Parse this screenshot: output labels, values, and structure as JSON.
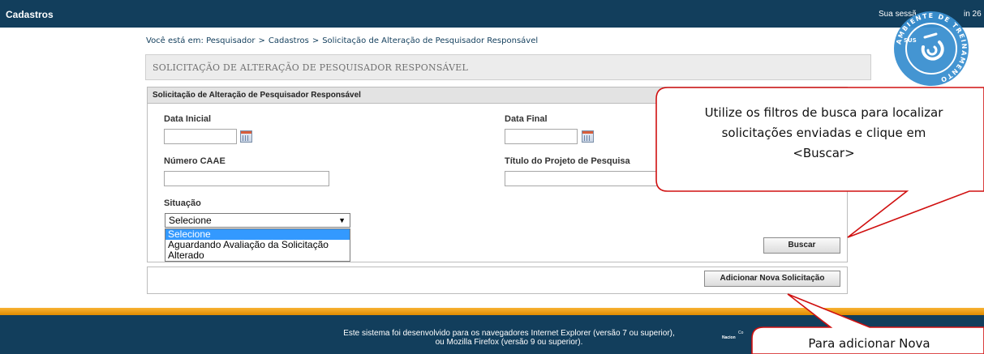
{
  "topbar": {
    "title": "Cadastros",
    "session_text": "Sua sessã",
    "session_end": "in 26"
  },
  "breadcrumb": {
    "prefix": "Você está em:",
    "items": [
      "Pesquisador",
      "Cadastros",
      "Solicitação de Alteração de Pesquisador Responsável"
    ]
  },
  "page_title": "SOLICITAÇÃO DE ALTERAÇÃO DE PESQUISADOR RESPONSÁVEL",
  "form": {
    "header": "Solicitação de Alteração de Pesquisador Responsável",
    "data_inicial_label": "Data Inicial",
    "data_inicial_value": "",
    "data_final_label": "Data Final",
    "data_final_value": "",
    "caae_label": "Número CAAE",
    "caae_value": "",
    "titulo_label": "Título do Projeto de Pesquisa",
    "titulo_value": "",
    "situacao_label": "Situação",
    "situacao_selected": "Selecione",
    "situacao_options": [
      "Selecione",
      "Aguardando Avaliação da Solicitação",
      "Alterado"
    ],
    "search_button": "Buscar",
    "add_button": "Adicionar Nova Solicitação"
  },
  "footer": {
    "line1": "Este sistema foi desenvolvido para os navegadores Internet Explorer (versão 7 ou superior),",
    "line2": "ou Mozilla Firefox (versão 9 ou superior).",
    "credit1": "Co",
    "credit2": "Nacion"
  },
  "callouts": {
    "filters_line1": "Utilize os filtros de busca para localizar",
    "filters_line2": "solicitações enviadas e clique em",
    "filters_line3": "<Buscar>",
    "add": "Para adicionar Nova"
  },
  "seal": {
    "text": "AMBIENTE DE TREINAMENTO",
    "sub": "SUS"
  },
  "colors": {
    "navy": "#123e5c",
    "orange": "#f8b334",
    "callout_border": "#d01010",
    "seal_blue": "#3a8fd0"
  }
}
